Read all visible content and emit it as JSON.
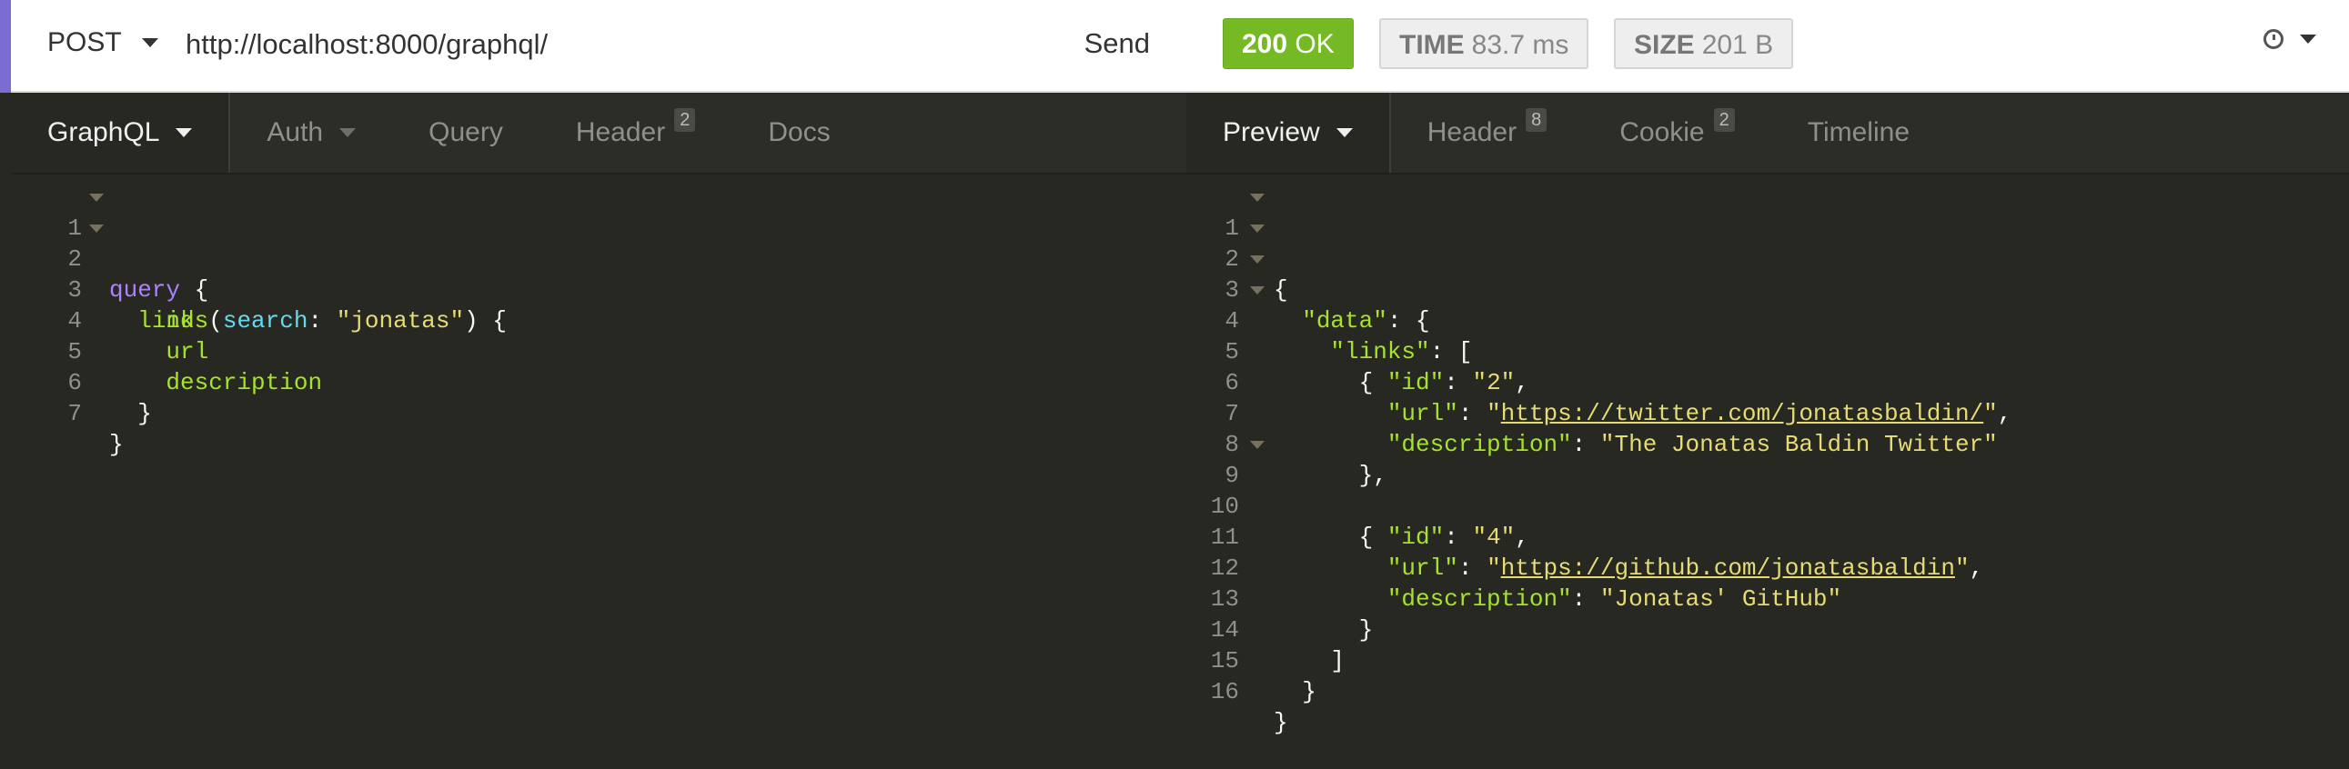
{
  "request": {
    "method": "POST",
    "url": "http://localhost:8000/graphql/",
    "send_label": "Send",
    "tabs": [
      {
        "label": "GraphQL",
        "active": true,
        "dropdown": true
      },
      {
        "label": "Auth",
        "dropdown": true
      },
      {
        "label": "Query"
      },
      {
        "label": "Header",
        "count": "2"
      },
      {
        "label": "Docs"
      }
    ],
    "gutter": [
      "1",
      "2",
      "3",
      "4",
      "5",
      "6",
      "7"
    ],
    "query": {
      "l1_kw": "query",
      "l1_brace": " {",
      "l2_fn": "links",
      "l2_open": "(",
      "l2_arg": "search",
      "l2_colon": ": ",
      "l2_str": "\"jonatas\"",
      "l2_close": ") {",
      "l3": "id",
      "l4": "url",
      "l5": "description",
      "l6": "}",
      "l7": "}"
    }
  },
  "response": {
    "status_code": "200",
    "status_text": "OK",
    "time_label": "TIME",
    "time_value": "83.7 ms",
    "size_label": "SIZE",
    "size_value": "201 B",
    "history_icon": "clock-icon",
    "tabs": [
      {
        "label": "Preview",
        "active": true,
        "dropdown": true
      },
      {
        "label": "Header",
        "count": "8"
      },
      {
        "label": "Cookie",
        "count": "2"
      },
      {
        "label": "Timeline"
      }
    ],
    "gutter": [
      "1",
      "2",
      "3",
      "4",
      "5",
      "6",
      "7",
      "8",
      "9",
      "10",
      "11",
      "12",
      "13",
      "14",
      "15",
      "16"
    ],
    "json": {
      "key_data": "\"data\"",
      "key_links": "\"links\"",
      "key_id": "\"id\"",
      "key_url": "\"url\"",
      "key_desc": "\"description\"",
      "item1_id": "\"2\"",
      "item1_url": "https://twitter.com/jonatasbaldin/",
      "item1_desc": "\"The Jonatas Baldin Twitter\"",
      "item2_id": "\"4\"",
      "item2_url": "https://github.com/jonatasbaldin",
      "item2_desc": "\"Jonatas' GitHub\""
    }
  },
  "colors": {
    "status_ok": "#75ba24",
    "accent": "#7a6cd1",
    "editor_bg": "#272822"
  }
}
